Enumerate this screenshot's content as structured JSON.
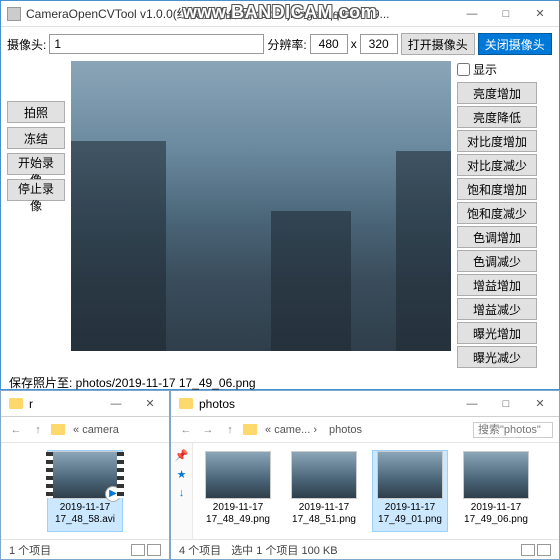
{
  "watermark": "www.BANDICAM.com",
  "main": {
    "title": "CameraOpenCVTool v1.0.0(红模仿 小作品 csdn: jianget/qq214979...",
    "camera_label": "摄像头:",
    "camera_index": "1",
    "res_label": "分辨率:",
    "res_w": "480",
    "res_x": "x",
    "res_h": "320",
    "open_btn": "打开摄像头",
    "close_btn": "关闭摄像头",
    "display_chk": "显示",
    "left_btns": [
      "拍照",
      "冻结",
      "开始录像",
      "停止录像"
    ],
    "right_btns": [
      "亮度增加",
      "亮度降低",
      "对比度增加",
      "对比度减少",
      "饱和度增加",
      "饱和度减少",
      "色调增加",
      "色调减少",
      "增益增加",
      "增益减少",
      "曝光增加",
      "曝光减少"
    ],
    "status": "保存照片至: photos/2019-11-17 17_49_06.png"
  },
  "exp1": {
    "title": "r",
    "crumb": "camera",
    "item_name": "2019-11-17 17_48_58.avi",
    "status": "1 个项目"
  },
  "exp2": {
    "title": "photos",
    "crumbs": [
      "came...",
      "photos"
    ],
    "search_placeholder": "搜索\"photos\"",
    "items": [
      "2019-11-17 17_48_49.png",
      "2019-11-17 17_48_51.png",
      "2019-11-17 17_49_01.png",
      "2019-11-17 17_49_06.png"
    ],
    "selected_index": 2,
    "status_count": "4 个项目",
    "status_sel": "选中 1 个项目  100 KB"
  }
}
